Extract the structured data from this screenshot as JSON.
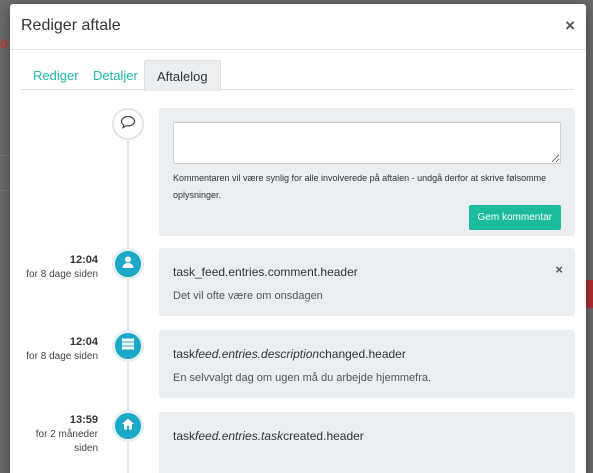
{
  "modal": {
    "title": "Rediger aftale",
    "close_glyph": "×"
  },
  "tabs": [
    {
      "label": "Rediger",
      "active": false
    },
    {
      "label": "Detaljer",
      "active": false
    },
    {
      "label": "Aftalelog",
      "active": true
    }
  ],
  "comment_form": {
    "input_value": "",
    "help_text": "Kommentaren vil være synlig for alle involverede på aftalen - undgå derfor at skrive følsomme oplysninger.",
    "save_label": "Gem kommentar"
  },
  "entries": [
    {
      "time": "12:04",
      "relative": "for 8 dage siden",
      "icon": "user-icon",
      "header": "task_feed.entries.comment.header",
      "body": "Det vil ofte være om onsdagen",
      "deletable": true
    },
    {
      "time": "12:04",
      "relative": "for 8 dage siden",
      "icon": "server-icon",
      "header_parts": [
        "task",
        "feed.entries.description",
        "changed.header"
      ],
      "body": "En selvvalgt dag om ugen må du arbejde hjemmefra."
    },
    {
      "time": "13:59",
      "relative_line1": "for 2 måneder",
      "relative_line2": "siden",
      "icon": "home-icon",
      "header_parts": [
        "task",
        "feed.entries.task",
        "created.header"
      ]
    }
  ],
  "colors": {
    "accent": "#1abc9c",
    "node": "#1aa9c9",
    "panel": "#eaeef1"
  }
}
